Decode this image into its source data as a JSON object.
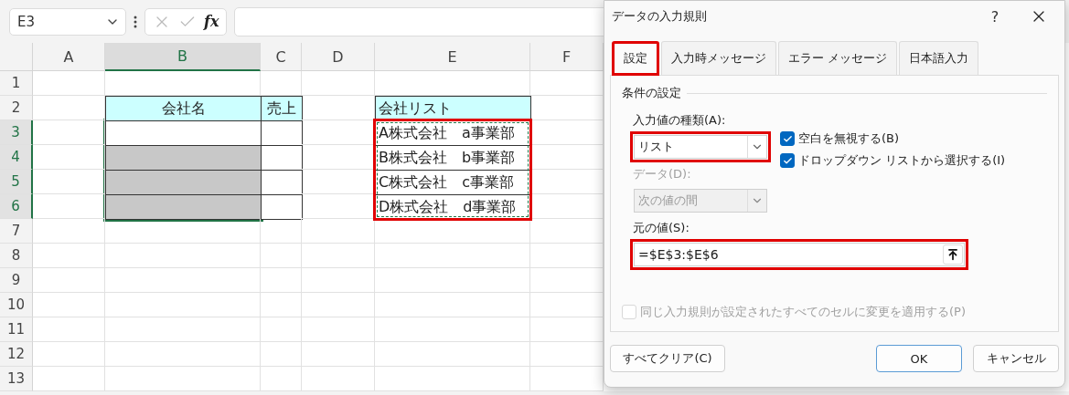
{
  "formula_bar": {
    "name_box": "E3",
    "function_label": "fx"
  },
  "columns": [
    {
      "label": "A",
      "selected": false
    },
    {
      "label": "B",
      "selected": true
    },
    {
      "label": "C",
      "selected": false
    },
    {
      "label": "D",
      "selected": false
    },
    {
      "label": "E",
      "selected": false
    },
    {
      "label": "F",
      "selected": false
    }
  ],
  "rows": [
    {
      "label": "1",
      "selected": false,
      "cells": [
        {
          "kind": "blank"
        },
        {
          "kind": "blank"
        },
        {
          "kind": "blank"
        },
        {
          "kind": "blank"
        },
        {
          "kind": "blank"
        },
        {
          "kind": "blank"
        }
      ]
    },
    {
      "label": "2",
      "selected": false,
      "cells": [
        {
          "kind": "blank"
        },
        {
          "kind": "header",
          "text": "会社名"
        },
        {
          "kind": "header",
          "text": "売上"
        },
        {
          "kind": "blank"
        },
        {
          "kind": "header_left",
          "text": "会社リスト"
        },
        {
          "kind": "blank"
        }
      ]
    },
    {
      "label": "3",
      "selected": true,
      "cells": [
        {
          "kind": "blank"
        },
        {
          "kind": "input"
        },
        {
          "kind": "input"
        },
        {
          "kind": "blank"
        },
        {
          "kind": "list",
          "text": "A株式会社　a事業部",
          "highlighted": true
        },
        {
          "kind": "blank"
        }
      ]
    },
    {
      "label": "4",
      "selected": true,
      "cells": [
        {
          "kind": "blank"
        },
        {
          "kind": "shaded"
        },
        {
          "kind": "input"
        },
        {
          "kind": "blank"
        },
        {
          "kind": "list",
          "text": "B株式会社　b事業部",
          "highlighted": true
        },
        {
          "kind": "blank"
        }
      ]
    },
    {
      "label": "5",
      "selected": true,
      "cells": [
        {
          "kind": "blank"
        },
        {
          "kind": "shaded"
        },
        {
          "kind": "input"
        },
        {
          "kind": "blank"
        },
        {
          "kind": "list",
          "text": "C株式会社　c事業部",
          "highlighted": true
        },
        {
          "kind": "blank"
        }
      ]
    },
    {
      "label": "6",
      "selected": true,
      "cells": [
        {
          "kind": "blank"
        },
        {
          "kind": "shaded"
        },
        {
          "kind": "input"
        },
        {
          "kind": "blank"
        },
        {
          "kind": "list",
          "text": "D株式会社　d事業部",
          "highlighted": true
        },
        {
          "kind": "blank"
        }
      ]
    },
    {
      "label": "7",
      "selected": false,
      "cells": [
        {
          "kind": "blank"
        },
        {
          "kind": "blank"
        },
        {
          "kind": "blank"
        },
        {
          "kind": "blank"
        },
        {
          "kind": "blank"
        },
        {
          "kind": "blank"
        }
      ]
    },
    {
      "label": "8",
      "selected": false,
      "cells": [
        {
          "kind": "blank"
        },
        {
          "kind": "blank"
        },
        {
          "kind": "blank"
        },
        {
          "kind": "blank"
        },
        {
          "kind": "blank"
        },
        {
          "kind": "blank"
        }
      ]
    },
    {
      "label": "9",
      "selected": false,
      "cells": [
        {
          "kind": "blank"
        },
        {
          "kind": "blank"
        },
        {
          "kind": "blank"
        },
        {
          "kind": "blank"
        },
        {
          "kind": "blank"
        },
        {
          "kind": "blank"
        }
      ]
    },
    {
      "label": "10",
      "selected": false,
      "cells": [
        {
          "kind": "blank"
        },
        {
          "kind": "blank"
        },
        {
          "kind": "blank"
        },
        {
          "kind": "blank"
        },
        {
          "kind": "blank"
        },
        {
          "kind": "blank"
        }
      ]
    },
    {
      "label": "11",
      "selected": false,
      "cells": [
        {
          "kind": "blank"
        },
        {
          "kind": "blank"
        },
        {
          "kind": "blank"
        },
        {
          "kind": "blank"
        },
        {
          "kind": "blank"
        },
        {
          "kind": "blank"
        }
      ]
    },
    {
      "label": "12",
      "selected": false,
      "cells": [
        {
          "kind": "blank"
        },
        {
          "kind": "blank"
        },
        {
          "kind": "blank"
        },
        {
          "kind": "blank"
        },
        {
          "kind": "blank"
        },
        {
          "kind": "blank"
        }
      ]
    },
    {
      "label": "13",
      "selected": false,
      "cells": [
        {
          "kind": "blank"
        },
        {
          "kind": "blank"
        },
        {
          "kind": "blank"
        },
        {
          "kind": "blank"
        },
        {
          "kind": "blank"
        },
        {
          "kind": "blank"
        }
      ]
    }
  ],
  "dialog": {
    "title": "データの入力規則",
    "help": "?",
    "tabs": [
      {
        "label": "設定",
        "selected": true,
        "highlighted": true
      },
      {
        "label": "入力時メッセージ",
        "selected": false,
        "highlighted": false
      },
      {
        "label": "エラー メッセージ",
        "selected": false,
        "highlighted": false
      },
      {
        "label": "日本語入力",
        "selected": false,
        "highlighted": false
      }
    ],
    "group_title": "条件の設定",
    "allow": {
      "label": "入力値の種類(A):",
      "value": "リスト",
      "highlighted": true,
      "disabled": false
    },
    "data": {
      "label": "データ(D):",
      "value": "次の値の間",
      "disabled": true
    },
    "checkboxes": [
      {
        "label": "空白を無視する(B)",
        "checked": true,
        "disabled": false
      },
      {
        "label": "ドロップダウン リストから選択する(I)",
        "checked": true,
        "disabled": false
      }
    ],
    "source": {
      "label": "元の値(S):",
      "value": "=$E$3:$E$6",
      "highlighted": true
    },
    "apply_all": {
      "label": "同じ入力規則が設定されたすべてのセルに変更を適用する(P)",
      "checked": false,
      "disabled": true
    },
    "buttons": [
      {
        "label": "すべてクリア(C)",
        "kind": "clear"
      },
      {
        "label": "OK",
        "kind": "default"
      },
      {
        "label": "キャンセル",
        "kind": "cancel"
      }
    ]
  }
}
